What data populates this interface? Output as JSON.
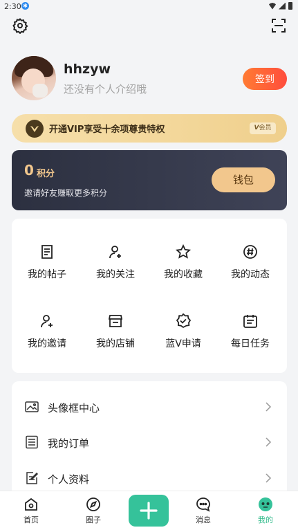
{
  "status": {
    "time": "2:30"
  },
  "profile": {
    "username": "hhzyw",
    "bio": "还没有个人介绍哦",
    "checkin_label": "签到"
  },
  "vip": {
    "text": "开通VIP享受十余项尊贵特权",
    "badge": "会员"
  },
  "wallet": {
    "points": "0",
    "points_label": "积分",
    "invite_text": "邀请好友赚取更多积分",
    "button_label": "钱包"
  },
  "grid": [
    {
      "label": "我的帖子",
      "icon": "posts-icon"
    },
    {
      "label": "我的关注",
      "icon": "follow-icon"
    },
    {
      "label": "我的收藏",
      "icon": "star-icon"
    },
    {
      "label": "我的动态",
      "icon": "hashtag-icon"
    },
    {
      "label": "我的邀请",
      "icon": "invite-icon"
    },
    {
      "label": "我的店铺",
      "icon": "shop-icon"
    },
    {
      "label": "蓝V申请",
      "icon": "verify-badge-icon"
    },
    {
      "label": "每日任务",
      "icon": "calendar-icon"
    }
  ],
  "list": [
    {
      "label": "头像框中心",
      "icon": "image-frame-icon"
    },
    {
      "label": "我的订单",
      "icon": "order-icon"
    },
    {
      "label": "个人资料",
      "icon": "profile-edit-icon"
    }
  ],
  "tabs": [
    {
      "label": "首页",
      "icon": "home-icon"
    },
    {
      "label": "圈子",
      "icon": "compass-icon"
    },
    {
      "label": "消息",
      "icon": "chat-icon"
    },
    {
      "label": "我的",
      "icon": "me-icon",
      "active": true
    }
  ],
  "colors": {
    "accent": "#35c29a",
    "checkin": "#ff5a3a",
    "gold": "#f2c78d"
  }
}
